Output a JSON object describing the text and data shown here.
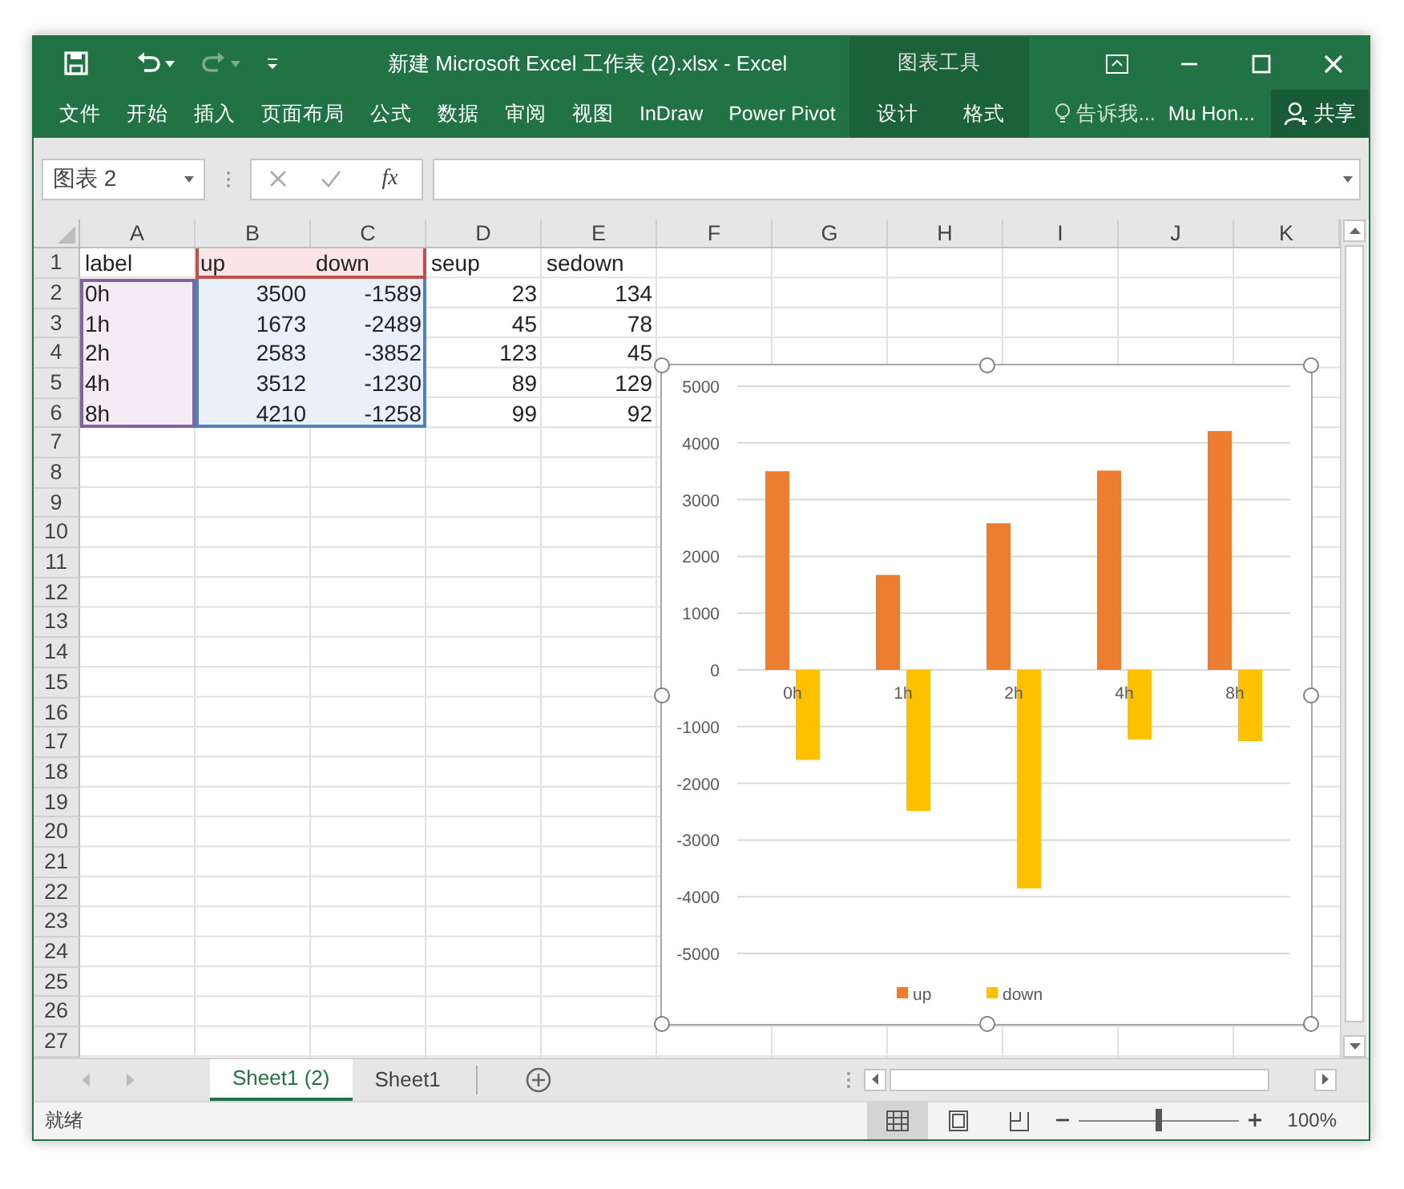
{
  "window": {
    "title": "新建 Microsoft Excel 工作表 (2).xlsx - Excel",
    "contextual_group": "图表工具"
  },
  "quick_access": [
    {
      "kind": "save",
      "disabled": false
    },
    {
      "kind": "undo",
      "disabled": false
    },
    {
      "kind": "redo",
      "disabled": true
    }
  ],
  "ribbon_tabs": [
    {
      "label": "文件",
      "selected": false,
      "contextual": false
    },
    {
      "label": "开始",
      "selected": false,
      "contextual": false
    },
    {
      "label": "插入",
      "selected": false,
      "contextual": false
    },
    {
      "label": "页面布局",
      "selected": false,
      "contextual": false
    },
    {
      "label": "公式",
      "selected": false,
      "contextual": false
    },
    {
      "label": "数据",
      "selected": false,
      "contextual": false
    },
    {
      "label": "审阅",
      "selected": false,
      "contextual": false
    },
    {
      "label": "视图",
      "selected": false,
      "contextual": false
    },
    {
      "label": "InDraw",
      "selected": false,
      "contextual": false
    },
    {
      "label": "Power Pivot",
      "selected": false,
      "contextual": false
    },
    {
      "label": "设计",
      "selected": false,
      "contextual": true
    },
    {
      "label": "格式",
      "selected": false,
      "contextual": true
    }
  ],
  "tell_me": {
    "placeholder": "告诉我..."
  },
  "user": "Mu Hon...",
  "share": "共享",
  "formula_bar": {
    "name_box": "图表 2",
    "insert_function": "fx"
  },
  "sheet": {
    "columns": [
      {
        "label": "A",
        "category_range": true,
        "series_range": false
      },
      {
        "label": "B",
        "category_range": false,
        "series_range": true
      },
      {
        "label": "C",
        "category_range": false,
        "series_range": true
      },
      {
        "label": "D",
        "category_range": false,
        "series_range": false
      },
      {
        "label": "E",
        "category_range": false,
        "series_range": false
      },
      {
        "label": "F"
      },
      {
        "label": "G"
      },
      {
        "label": "H"
      },
      {
        "label": "I"
      },
      {
        "label": "J"
      },
      {
        "label": "K"
      }
    ],
    "row_numbers": [
      "1",
      "2",
      "3",
      "4",
      "5",
      "6",
      "7",
      "8",
      "9",
      "10",
      "11",
      "12",
      "13",
      "14",
      "15",
      "16",
      "17",
      "18",
      "19",
      "20",
      "21",
      "22",
      "23",
      "24",
      "25",
      "26",
      "27"
    ],
    "rows": [
      {
        "kind": "header",
        "cells": [
          "label",
          "up",
          "down",
          "seup",
          "sedown"
        ]
      },
      {
        "kind": "data",
        "cells": [
          "0h",
          "3500",
          "-1589",
          "23",
          "134"
        ]
      },
      {
        "kind": "data",
        "cells": [
          "1h",
          "1673",
          "-2489",
          "45",
          "78"
        ]
      },
      {
        "kind": "data",
        "cells": [
          "2h",
          "2583",
          "-3852",
          "123",
          "45"
        ]
      },
      {
        "kind": "data",
        "cells": [
          "4h",
          "3512",
          "-1230",
          "89",
          "129"
        ]
      },
      {
        "kind": "data",
        "cells": [
          "8h",
          "4210",
          "-1258",
          "99",
          "92"
        ]
      }
    ]
  },
  "chart": {
    "selected": true,
    "chart_data": {
      "type": "bar",
      "grid": true,
      "legend": "bottom",
      "categories": [
        "0h",
        "1h",
        "2h",
        "4h",
        "8h"
      ],
      "series": [
        {
          "name": "up",
          "color": "#ed7d31",
          "values": [
            3500,
            1673,
            2583,
            3512,
            4210
          ]
        },
        {
          "name": "down",
          "color": "#ffc000",
          "values": [
            -1589,
            -2489,
            -3852,
            -1230,
            -1258
          ]
        }
      ],
      "ylim": [
        -5000,
        5000
      ],
      "yticks": [
        -5000,
        -4000,
        -3000,
        -2000,
        -1000,
        0,
        1000,
        2000,
        3000,
        4000,
        5000
      ]
    }
  },
  "sheet_tabs": [
    {
      "label": "Sheet1 (2)",
      "selected": true
    },
    {
      "label": "Sheet1",
      "selected": false
    }
  ],
  "status_bar": {
    "status": "就绪",
    "views": [
      {
        "kind": "normal",
        "selected": true
      },
      {
        "kind": "page_layout",
        "selected": false
      },
      {
        "kind": "page_break",
        "selected": false
      }
    ],
    "zoom": {
      "level": 0.5,
      "reading": "100%"
    }
  }
}
